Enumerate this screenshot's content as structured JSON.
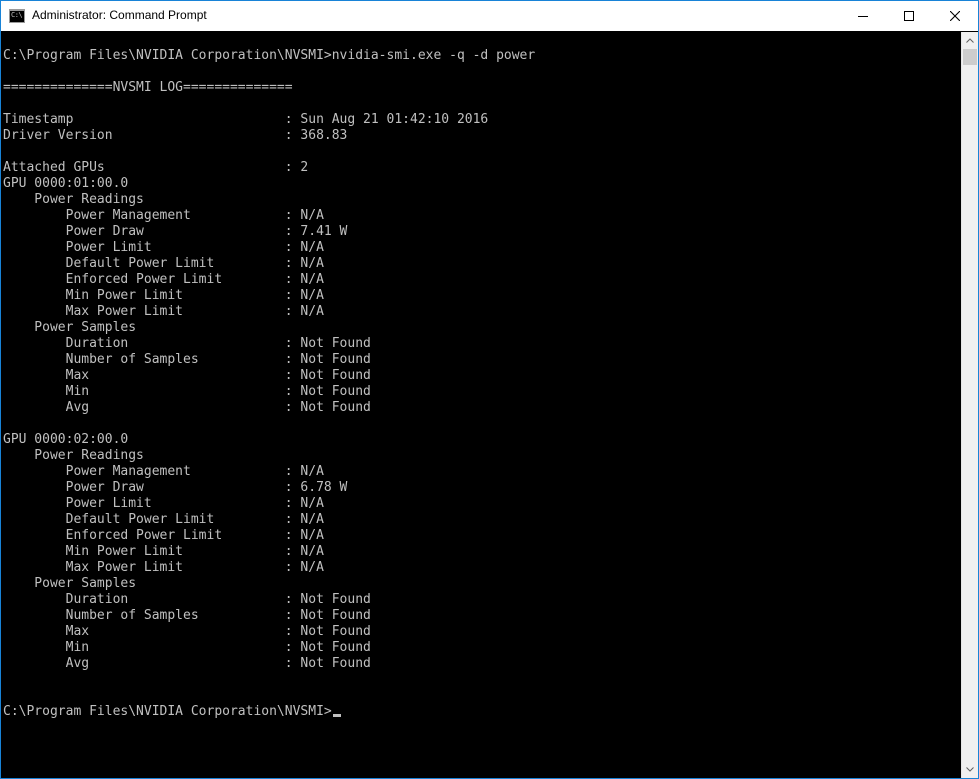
{
  "window": {
    "title": "Administrator: Command Prompt",
    "app_icon_glyph": "C:\\",
    "icons": {
      "app": "command-prompt-icon",
      "minimize": "minimize-icon",
      "maximize": "maximize-icon",
      "close": "close-icon",
      "scroll_up": "chevron-up-icon",
      "scroll_down": "chevron-down-icon"
    }
  },
  "colors": {
    "console_background": "#000000",
    "console_text": "#c0c0c0",
    "titlebar_background": "#ffffff",
    "window_border": "#1883d7"
  },
  "console": {
    "lines": [
      "C:\\Program Files\\NVIDIA Corporation\\NVSMI>nvidia-smi.exe -q -d power",
      "",
      "==============NVSMI LOG==============",
      "",
      "Timestamp                           : Sun Aug 21 01:42:10 2016",
      "Driver Version                      : 368.83",
      "",
      "Attached GPUs                       : 2",
      "GPU 0000:01:00.0",
      "    Power Readings",
      "        Power Management            : N/A",
      "        Power Draw                  : 7.41 W",
      "        Power Limit                 : N/A",
      "        Default Power Limit         : N/A",
      "        Enforced Power Limit        : N/A",
      "        Min Power Limit             : N/A",
      "        Max Power Limit             : N/A",
      "    Power Samples",
      "        Duration                    : Not Found",
      "        Number of Samples           : Not Found",
      "        Max                         : Not Found",
      "        Min                         : Not Found",
      "        Avg                         : Not Found",
      "",
      "GPU 0000:02:00.0",
      "    Power Readings",
      "        Power Management            : N/A",
      "        Power Draw                  : 6.78 W",
      "        Power Limit                 : N/A",
      "        Default Power Limit         : N/A",
      "        Enforced Power Limit        : N/A",
      "        Min Power Limit             : N/A",
      "        Max Power Limit             : N/A",
      "    Power Samples",
      "        Duration                    : Not Found",
      "        Number of Samples           : Not Found",
      "        Max                         : Not Found",
      "        Min                         : Not Found",
      "        Avg                         : Not Found",
      "",
      ""
    ],
    "prompt": "C:\\Program Files\\NVIDIA Corporation\\NVSMI>"
  }
}
